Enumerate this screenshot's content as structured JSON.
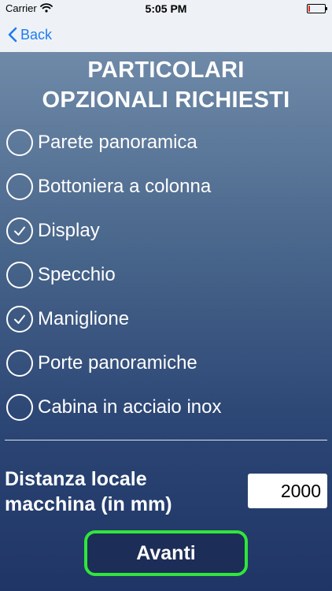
{
  "status_bar": {
    "carrier": "Carrier",
    "time": "5:05 PM",
    "battery_level": 0.1,
    "battery_color": "#e02020"
  },
  "nav": {
    "back_label": "Back"
  },
  "page": {
    "title_line1": "PARTICOLARI",
    "title_line2": "OPZIONALI RICHIESTI"
  },
  "options": [
    {
      "label": "Parete panoramica",
      "checked": false
    },
    {
      "label": "Bottoniera a colonna",
      "checked": false
    },
    {
      "label": "Display",
      "checked": true
    },
    {
      "label": "Specchio",
      "checked": false
    },
    {
      "label": "Maniglione",
      "checked": true
    },
    {
      "label": "Porte panoramiche",
      "checked": false
    },
    {
      "label": "Cabina in acciaio inox",
      "checked": false
    }
  ],
  "distance": {
    "label_line1": "Distanza locale",
    "label_line2": "macchina (in mm)",
    "value": "2000"
  },
  "actions": {
    "next_label": "Avanti"
  },
  "colors": {
    "accent": "#1e7cf0",
    "button_border": "#30e63a",
    "button_bg": "#1c2d57"
  }
}
